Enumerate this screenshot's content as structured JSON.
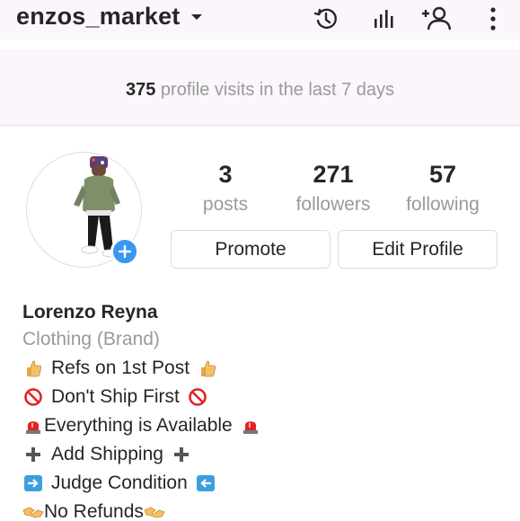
{
  "header": {
    "username": "enzos_market",
    "icons": [
      "history-icon",
      "insights-icon",
      "add-user-icon",
      "more-options-icon"
    ]
  },
  "visits": {
    "count": "375",
    "text": "profile visits in the last 7 days"
  },
  "stats": {
    "posts": {
      "value": "3",
      "label": "posts"
    },
    "followers": {
      "value": "271",
      "label": "followers"
    },
    "following": {
      "value": "57",
      "label": "following"
    }
  },
  "buttons": {
    "promote": "Promote",
    "edit_profile": "Edit Profile"
  },
  "bio": {
    "name": "Lorenzo Reyna",
    "category": "Clothing (Brand)",
    "lines": [
      {
        "text": "Refs on 1st Post",
        "emoji": "thumbs-up-icon"
      },
      {
        "text": "Don't Ship First",
        "emoji": "prohibited-icon"
      },
      {
        "text": "Everything is Available",
        "emoji": "siren-icon"
      },
      {
        "text": "Add Shipping",
        "emoji": "plus-icon"
      },
      {
        "text": "Judge Condition",
        "emoji": "arrow-icon"
      },
      {
        "text": "No Refunds",
        "emoji": "handshake-icon"
      }
    ]
  },
  "colors": {
    "accent_blue": "#3897f0",
    "muted_text": "#9a9a9a",
    "header_bg": "#faf6fb"
  }
}
